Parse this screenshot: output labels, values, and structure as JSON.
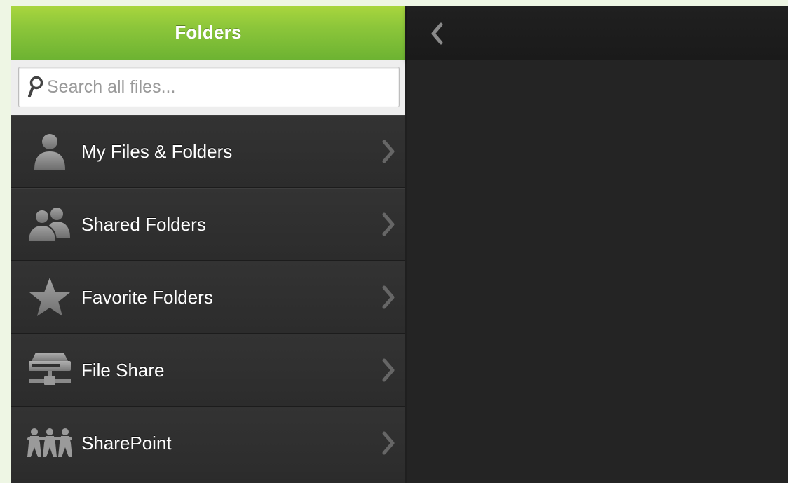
{
  "sidebar": {
    "title": "Folders",
    "search": {
      "placeholder": "Search all files...",
      "value": ""
    },
    "items": [
      {
        "label": "My Files & Folders",
        "icon": "person-icon"
      },
      {
        "label": "Shared Folders",
        "icon": "people-icon"
      },
      {
        "label": "Favorite Folders",
        "icon": "star-icon"
      },
      {
        "label": "File Share",
        "icon": "server-icon"
      },
      {
        "label": "SharePoint",
        "icon": "sharepoint-people-icon"
      }
    ]
  },
  "main": {
    "back_icon": "chevron-left-icon"
  },
  "colors": {
    "header_green": "#8cc63a",
    "sidebar_bg": "#2b2b2b",
    "main_bg": "#232323",
    "icon_gray": "#8a8a8a"
  }
}
